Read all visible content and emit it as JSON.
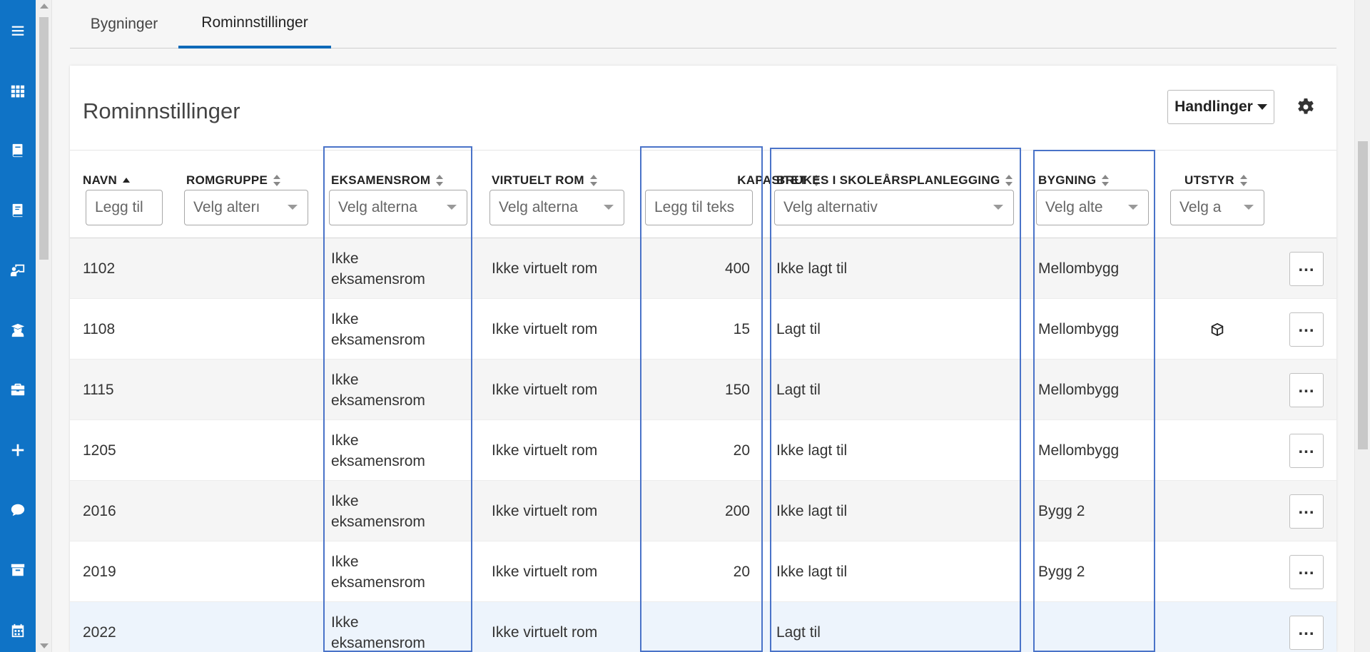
{
  "tabs": [
    {
      "label": "Bygninger",
      "active": false
    },
    {
      "label": "Rominnstillinger",
      "active": true
    }
  ],
  "card": {
    "title": "Rominnstillinger",
    "actions_label": "Handlinger"
  },
  "columns": {
    "navn": {
      "label": "NAVN",
      "filter_placeholder": "Legg til"
    },
    "romgruppe": {
      "label": "ROMGRUPPE",
      "filter_placeholder": "Velg alterı"
    },
    "eksamensrom": {
      "label": "EKSAMENSROM",
      "filter_placeholder": "Velg alterna"
    },
    "virtuelt_rom": {
      "label": "VIRTUELT ROM",
      "filter_placeholder": "Velg alterna"
    },
    "kapasitet": {
      "label": "KAPASITET",
      "filter_placeholder": "Legg til teks"
    },
    "brukes": {
      "label": "BRUKES I SKOLEÅRSPLANLEGGING",
      "filter_placeholder": "Velg alternativ"
    },
    "bygning": {
      "label": "BYGNING",
      "filter_placeholder": "Velg alte"
    },
    "utstyr": {
      "label": "UTSTYR",
      "filter_placeholder": "Velg a"
    }
  },
  "rows": [
    {
      "navn": "1102",
      "eksamensrom_1": "Ikke",
      "eksamensrom_2": "eksamensrom",
      "virtuelt_rom": "Ikke virtuelt rom",
      "kapasitet": "400",
      "brukes": "Ikke lagt til",
      "bygning": "Mellombygg",
      "utstyr_icon": ""
    },
    {
      "navn": "1108",
      "eksamensrom_1": "Ikke",
      "eksamensrom_2": "eksamensrom",
      "virtuelt_rom": "Ikke virtuelt rom",
      "kapasitet": "15",
      "brukes": "Lagt til",
      "bygning": "Mellombygg",
      "utstyr_icon": "cube-icon"
    },
    {
      "navn": "1115",
      "eksamensrom_1": "Ikke",
      "eksamensrom_2": "eksamensrom",
      "virtuelt_rom": "Ikke virtuelt rom",
      "kapasitet": "150",
      "brukes": "Lagt til",
      "bygning": "Mellombygg",
      "utstyr_icon": ""
    },
    {
      "navn": "1205",
      "eksamensrom_1": "Ikke",
      "eksamensrom_2": "eksamensrom",
      "virtuelt_rom": "Ikke virtuelt rom",
      "kapasitet": "20",
      "brukes": "Ikke lagt til",
      "bygning": "Mellombygg",
      "utstyr_icon": ""
    },
    {
      "navn": "2016",
      "eksamensrom_1": "Ikke",
      "eksamensrom_2": "eksamensrom",
      "virtuelt_rom": "Ikke virtuelt rom",
      "kapasitet": "200",
      "brukes": "Ikke lagt til",
      "bygning": "Bygg 2",
      "utstyr_icon": ""
    },
    {
      "navn": "2019",
      "eksamensrom_1": "Ikke",
      "eksamensrom_2": "eksamensrom",
      "virtuelt_rom": "Ikke virtuelt rom",
      "kapasitet": "20",
      "brukes": "Ikke lagt til",
      "bygning": "Bygg 2",
      "utstyr_icon": ""
    },
    {
      "navn": "2022",
      "eksamensrom_1": "Ikke",
      "eksamensrom_2": "eksamensrom",
      "virtuelt_rom": "Ikke virtuelt rom",
      "kapasitet": "",
      "brukes": "Lagt til",
      "bygning": "",
      "utstyr_icon": ""
    }
  ],
  "nav_icons": [
    "menu-icon",
    "apps-grid-icon",
    "book-icon",
    "book-alt-icon",
    "teacher-board-icon",
    "graduate-icon",
    "briefcase-icon",
    "plus-icon",
    "chat-icon",
    "archive-icon",
    "calendar-icon"
  ],
  "colors": {
    "rail": "#0f73c6",
    "tab_active": "#0f6ab8",
    "annotation": "#4a73c8"
  }
}
